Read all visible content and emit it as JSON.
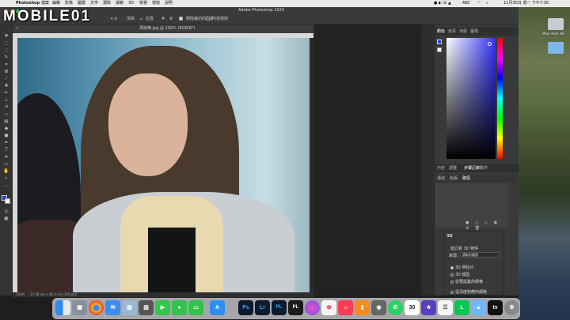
{
  "menubar": {
    "app_name": "Photoshop",
    "items": [
      "檔案",
      "編輯",
      "影像",
      "圖層",
      "文字",
      "選取",
      "濾鏡",
      "3D",
      "檢視",
      "視窗",
      "說明"
    ],
    "input_method": "ABC",
    "clock": "11月30日 週一 下午7:30"
  },
  "window": {
    "title": "Adobe Photoshop 2020"
  },
  "options_bar": {
    "clear_label": "清除",
    "rotate_label": "拉直",
    "delete_cropped_label": "刪除裁切的像素",
    "delete_cropped_checked": true,
    "content_aware_label": "內容感知",
    "content_aware_checked": false
  },
  "document": {
    "tab_title": "貝絲琳.jpg @ 100% (RGB/8*)",
    "zoom": "100%",
    "dimensions": "37.08 cm x 36.4 cm (144 ppi)"
  },
  "panels": {
    "top_tabs": [
      "顏色",
      "色票",
      "漸層",
      "圖樣"
    ],
    "mid_tabs": [
      "內容",
      "調整",
      "步驟記錄",
      "動作"
    ],
    "mid_active": "步驟記錄",
    "sub_tabs": [
      "通道",
      "色版",
      "路徑"
    ],
    "sub_active": "路徑",
    "panel3d": {
      "title": "3D",
      "new_object_label": "建立新 3D 物件",
      "source_label": "來源：",
      "source_value": "選取的圖層",
      "options": [
        "3D 明信片",
        "3D 模型",
        "從預設集的網格",
        "從深度對應的網格"
      ],
      "selected_option": "3D 明信片"
    }
  },
  "desktop": {
    "drive_label": "Macintosh HD",
    "watermark": "MOBILE01"
  },
  "dock": {
    "apps": [
      "Finder",
      "Launchpad",
      "Chrome",
      "Mail",
      "Preview",
      "Calculator",
      "FaceTime",
      "Messages",
      "Photoshop",
      "Lightroom",
      "Lightroom Classic",
      "Siri",
      "Photos",
      "Music",
      "Books",
      "Screenshot",
      "WhatsApp",
      "Calendar",
      "iMovie",
      "Reminders",
      "LINE",
      "Maps",
      "Apple TV",
      "System Preferences",
      "Trash"
    ],
    "calendar_day": "30"
  },
  "colors": {
    "ps_dark": "#333333",
    "ps_panel": "#393939",
    "accent": "#1473e6"
  }
}
